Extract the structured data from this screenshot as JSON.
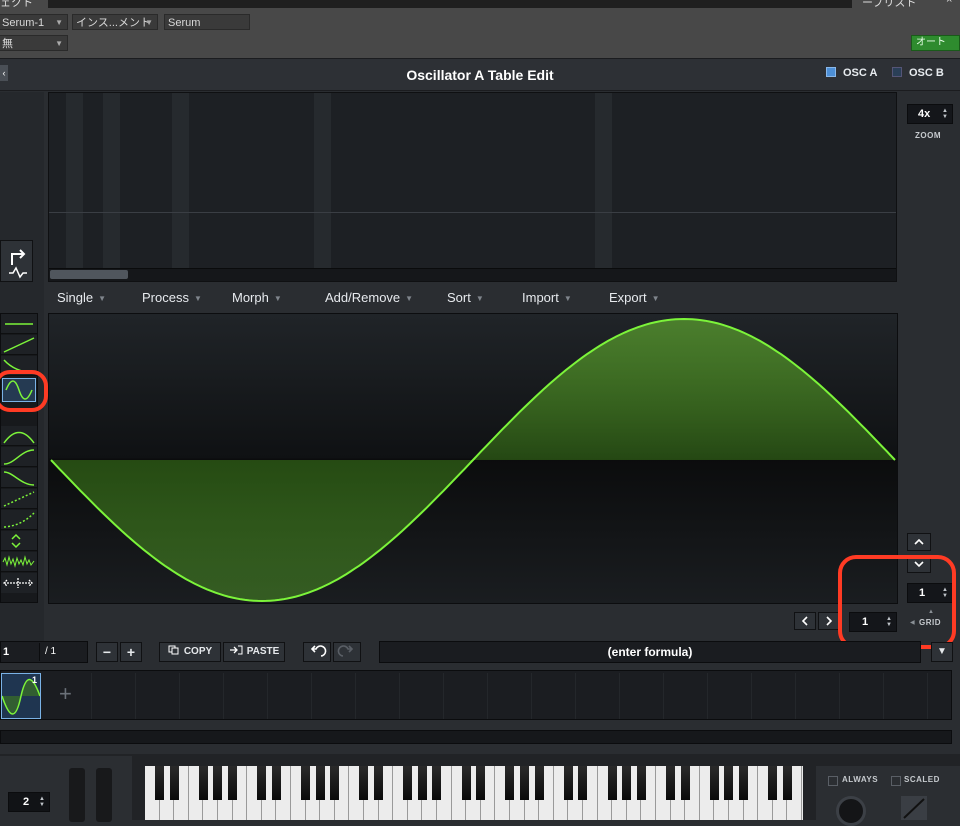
{
  "host": {
    "top_partial_left": "ェクト",
    "top_partial_right": "ープリスト",
    "preset_name": "Serum-1",
    "instrument": "インス...メント",
    "plugin": "Serum",
    "mode": "無",
    "auto_label": "オート"
  },
  "editor": {
    "title": "Oscillator A Table Edit",
    "close_glyph": "×",
    "osc_a": "OSC A",
    "osc_b": "OSC B"
  },
  "zoom": {
    "value": "4x",
    "label": "ZOOM"
  },
  "menus": [
    {
      "label": "Single"
    },
    {
      "label": "Process"
    },
    {
      "label": "Morph"
    },
    {
      "label": "Add/Remove"
    },
    {
      "label": "Sort"
    },
    {
      "label": "Import"
    },
    {
      "label": "Export"
    }
  ],
  "waveform": {
    "shape": "sine",
    "phase_inverted": true,
    "color": "#7cf43a"
  },
  "grid": {
    "value_right": "1",
    "label": "GRID",
    "value_bottom": "1"
  },
  "frames": {
    "current": "1",
    "total": "/ 1",
    "thumb_index": "1"
  },
  "buttons": {
    "minus": "−",
    "plus": "+",
    "copy": "COPY",
    "paste": "PASTE"
  },
  "formula": {
    "placeholder": "(enter formula)"
  },
  "keyboard": {
    "octave_value": "2",
    "always_label": "ALWAYS",
    "scaled_label": "SCALED"
  },
  "colors": {
    "accent": "#7cf43a",
    "highlight_ring": "#ff3b24",
    "host_auto": "#2e8b2e"
  }
}
